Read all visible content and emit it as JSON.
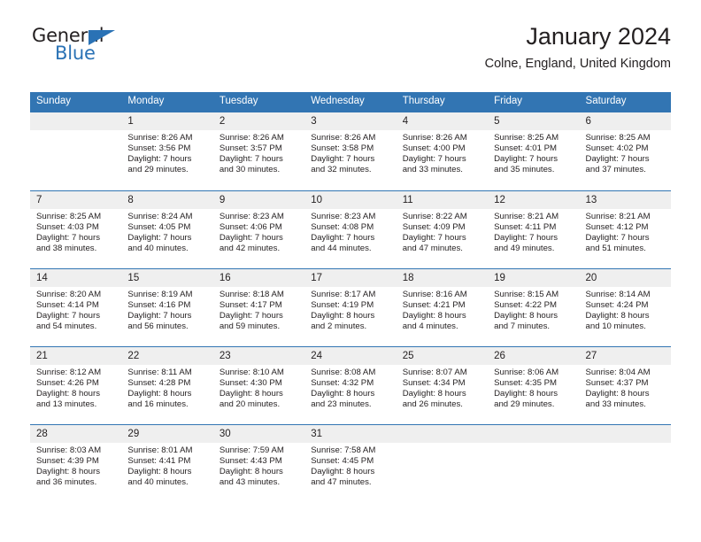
{
  "logo": {
    "word_one": "General",
    "word_two": "Blue",
    "triangle_color": "#2a72b5"
  },
  "header": {
    "title": "January 2024",
    "subtitle": "Colne, England, United Kingdom",
    "accent_color": "#3275b3",
    "day_band_color": "#efefef"
  },
  "weekdays": [
    "Sunday",
    "Monday",
    "Tuesday",
    "Wednesday",
    "Thursday",
    "Friday",
    "Saturday"
  ],
  "weeks": [
    [
      {
        "day": "",
        "lines": []
      },
      {
        "day": "1",
        "lines": [
          "Sunrise: 8:26 AM",
          "Sunset: 3:56 PM",
          "Daylight: 7 hours",
          "and 29 minutes."
        ]
      },
      {
        "day": "2",
        "lines": [
          "Sunrise: 8:26 AM",
          "Sunset: 3:57 PM",
          "Daylight: 7 hours",
          "and 30 minutes."
        ]
      },
      {
        "day": "3",
        "lines": [
          "Sunrise: 8:26 AM",
          "Sunset: 3:58 PM",
          "Daylight: 7 hours",
          "and 32 minutes."
        ]
      },
      {
        "day": "4",
        "lines": [
          "Sunrise: 8:26 AM",
          "Sunset: 4:00 PM",
          "Daylight: 7 hours",
          "and 33 minutes."
        ]
      },
      {
        "day": "5",
        "lines": [
          "Sunrise: 8:25 AM",
          "Sunset: 4:01 PM",
          "Daylight: 7 hours",
          "and 35 minutes."
        ]
      },
      {
        "day": "6",
        "lines": [
          "Sunrise: 8:25 AM",
          "Sunset: 4:02 PM",
          "Daylight: 7 hours",
          "and 37 minutes."
        ]
      }
    ],
    [
      {
        "day": "7",
        "lines": [
          "Sunrise: 8:25 AM",
          "Sunset: 4:03 PM",
          "Daylight: 7 hours",
          "and 38 minutes."
        ]
      },
      {
        "day": "8",
        "lines": [
          "Sunrise: 8:24 AM",
          "Sunset: 4:05 PM",
          "Daylight: 7 hours",
          "and 40 minutes."
        ]
      },
      {
        "day": "9",
        "lines": [
          "Sunrise: 8:23 AM",
          "Sunset: 4:06 PM",
          "Daylight: 7 hours",
          "and 42 minutes."
        ]
      },
      {
        "day": "10",
        "lines": [
          "Sunrise: 8:23 AM",
          "Sunset: 4:08 PM",
          "Daylight: 7 hours",
          "and 44 minutes."
        ]
      },
      {
        "day": "11",
        "lines": [
          "Sunrise: 8:22 AM",
          "Sunset: 4:09 PM",
          "Daylight: 7 hours",
          "and 47 minutes."
        ]
      },
      {
        "day": "12",
        "lines": [
          "Sunrise: 8:21 AM",
          "Sunset: 4:11 PM",
          "Daylight: 7 hours",
          "and 49 minutes."
        ]
      },
      {
        "day": "13",
        "lines": [
          "Sunrise: 8:21 AM",
          "Sunset: 4:12 PM",
          "Daylight: 7 hours",
          "and 51 minutes."
        ]
      }
    ],
    [
      {
        "day": "14",
        "lines": [
          "Sunrise: 8:20 AM",
          "Sunset: 4:14 PM",
          "Daylight: 7 hours",
          "and 54 minutes."
        ]
      },
      {
        "day": "15",
        "lines": [
          "Sunrise: 8:19 AM",
          "Sunset: 4:16 PM",
          "Daylight: 7 hours",
          "and 56 minutes."
        ]
      },
      {
        "day": "16",
        "lines": [
          "Sunrise: 8:18 AM",
          "Sunset: 4:17 PM",
          "Daylight: 7 hours",
          "and 59 minutes."
        ]
      },
      {
        "day": "17",
        "lines": [
          "Sunrise: 8:17 AM",
          "Sunset: 4:19 PM",
          "Daylight: 8 hours",
          "and 2 minutes."
        ]
      },
      {
        "day": "18",
        "lines": [
          "Sunrise: 8:16 AM",
          "Sunset: 4:21 PM",
          "Daylight: 8 hours",
          "and 4 minutes."
        ]
      },
      {
        "day": "19",
        "lines": [
          "Sunrise: 8:15 AM",
          "Sunset: 4:22 PM",
          "Daylight: 8 hours",
          "and 7 minutes."
        ]
      },
      {
        "day": "20",
        "lines": [
          "Sunrise: 8:14 AM",
          "Sunset: 4:24 PM",
          "Daylight: 8 hours",
          "and 10 minutes."
        ]
      }
    ],
    [
      {
        "day": "21",
        "lines": [
          "Sunrise: 8:12 AM",
          "Sunset: 4:26 PM",
          "Daylight: 8 hours",
          "and 13 minutes."
        ]
      },
      {
        "day": "22",
        "lines": [
          "Sunrise: 8:11 AM",
          "Sunset: 4:28 PM",
          "Daylight: 8 hours",
          "and 16 minutes."
        ]
      },
      {
        "day": "23",
        "lines": [
          "Sunrise: 8:10 AM",
          "Sunset: 4:30 PM",
          "Daylight: 8 hours",
          "and 20 minutes."
        ]
      },
      {
        "day": "24",
        "lines": [
          "Sunrise: 8:08 AM",
          "Sunset: 4:32 PM",
          "Daylight: 8 hours",
          "and 23 minutes."
        ]
      },
      {
        "day": "25",
        "lines": [
          "Sunrise: 8:07 AM",
          "Sunset: 4:34 PM",
          "Daylight: 8 hours",
          "and 26 minutes."
        ]
      },
      {
        "day": "26",
        "lines": [
          "Sunrise: 8:06 AM",
          "Sunset: 4:35 PM",
          "Daylight: 8 hours",
          "and 29 minutes."
        ]
      },
      {
        "day": "27",
        "lines": [
          "Sunrise: 8:04 AM",
          "Sunset: 4:37 PM",
          "Daylight: 8 hours",
          "and 33 minutes."
        ]
      }
    ],
    [
      {
        "day": "28",
        "lines": [
          "Sunrise: 8:03 AM",
          "Sunset: 4:39 PM",
          "Daylight: 8 hours",
          "and 36 minutes."
        ]
      },
      {
        "day": "29",
        "lines": [
          "Sunrise: 8:01 AM",
          "Sunset: 4:41 PM",
          "Daylight: 8 hours",
          "and 40 minutes."
        ]
      },
      {
        "day": "30",
        "lines": [
          "Sunrise: 7:59 AM",
          "Sunset: 4:43 PM",
          "Daylight: 8 hours",
          "and 43 minutes."
        ]
      },
      {
        "day": "31",
        "lines": [
          "Sunrise: 7:58 AM",
          "Sunset: 4:45 PM",
          "Daylight: 8 hours",
          "and 47 minutes."
        ]
      },
      {
        "day": "",
        "lines": []
      },
      {
        "day": "",
        "lines": []
      },
      {
        "day": "",
        "lines": []
      }
    ]
  ]
}
